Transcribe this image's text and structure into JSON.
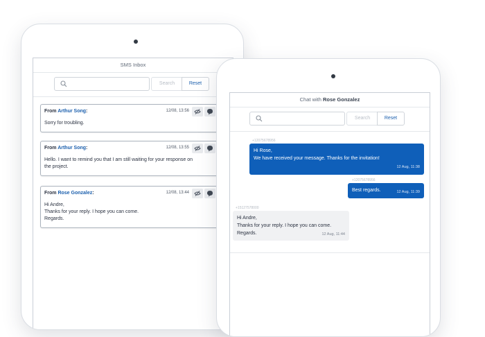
{
  "inbox": {
    "title": "SMS Inbox",
    "search_button": "Search",
    "reset_button": "Reset",
    "messages": [
      {
        "from_prefix": "From",
        "from_name": "Arthur Song",
        "time": "12/08, 13:56",
        "lines": [
          "Sorry for troubling."
        ]
      },
      {
        "from_prefix": "From",
        "from_name": "Arthur Song",
        "time": "12/08, 13:55",
        "lines": [
          "Hello. I want to remind you that I am still waiting for your response on",
          "the project."
        ]
      },
      {
        "from_prefix": "From",
        "from_name": "Rose Gonzalez",
        "time": "12/08, 13:44",
        "lines": [
          "Hi Andre,",
          "Thanks for your reply. I hope you can come.",
          "Regards."
        ]
      }
    ]
  },
  "chat": {
    "title_prefix": "Chat with",
    "title_name": "Rose Gonzalez",
    "search_button": "Search",
    "reset_button": "Reset",
    "messages": [
      {
        "direction": "out",
        "phone": "+12075678956",
        "lines": [
          "Hi Rose,",
          "We have received your message. Thanks for the invitation!"
        ],
        "time": "12 Aug, 11:38"
      },
      {
        "direction": "out",
        "phone": "+12075678956",
        "lines": [
          "Best regards."
        ],
        "time": "12 Aug, 11:39"
      },
      {
        "direction": "in",
        "phone": "+15127578000",
        "lines": [
          "Hi Andre,",
          "Thanks for your reply. I hope you can come.",
          "Regards."
        ],
        "time": "12 Aug, 11:44"
      }
    ]
  },
  "colors": {
    "accent": "#0f5fb9",
    "link": "#1b5fad"
  },
  "icons": {
    "search": "search-icon",
    "hide": "hide-icon",
    "reply": "chat-bubble-icon"
  }
}
